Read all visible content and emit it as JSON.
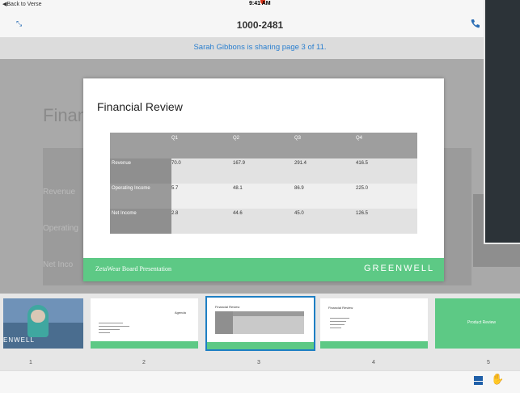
{
  "status": {
    "back": "◀Back to Verse",
    "time": "9:41 AM"
  },
  "meeting": {
    "id": "1000-2481"
  },
  "sharing": {
    "text": "Sarah Gibbons is sharing page 3 of 11."
  },
  "background_slide": {
    "title": "Finan",
    "rows": [
      "Revenue",
      "Operating",
      "Net Inco"
    ]
  },
  "slide": {
    "title": "Financial Review",
    "table": {
      "headers": [
        "",
        "Q1",
        "Q2",
        "Q3",
        "Q4"
      ],
      "rows": [
        {
          "label": "Revenue",
          "values": [
            "70.0",
            "167.9",
            "291.4",
            "416.5"
          ]
        },
        {
          "label": "Operating Income",
          "values": [
            "5.7",
            "48.1",
            "86.9",
            "225.0"
          ]
        },
        {
          "label": "Net Income",
          "values": [
            "2.8",
            "44.6",
            "45.0",
            "126.5"
          ]
        }
      ]
    },
    "footer_text": "ZetaWear Board Presentation",
    "brand": "GREENWELL"
  },
  "thumbnails": [
    {
      "num": "1",
      "label": "ENWELL"
    },
    {
      "num": "2",
      "label": "Agenda"
    },
    {
      "num": "3",
      "label": "Financial Review"
    },
    {
      "num": "4",
      "label": "Financial Review"
    },
    {
      "num": "5",
      "label": "Product Review"
    }
  ],
  "colors": {
    "accent": "#2a7fcf",
    "brand_green": "#5dc985",
    "selected_border": "#1e7fc4"
  }
}
